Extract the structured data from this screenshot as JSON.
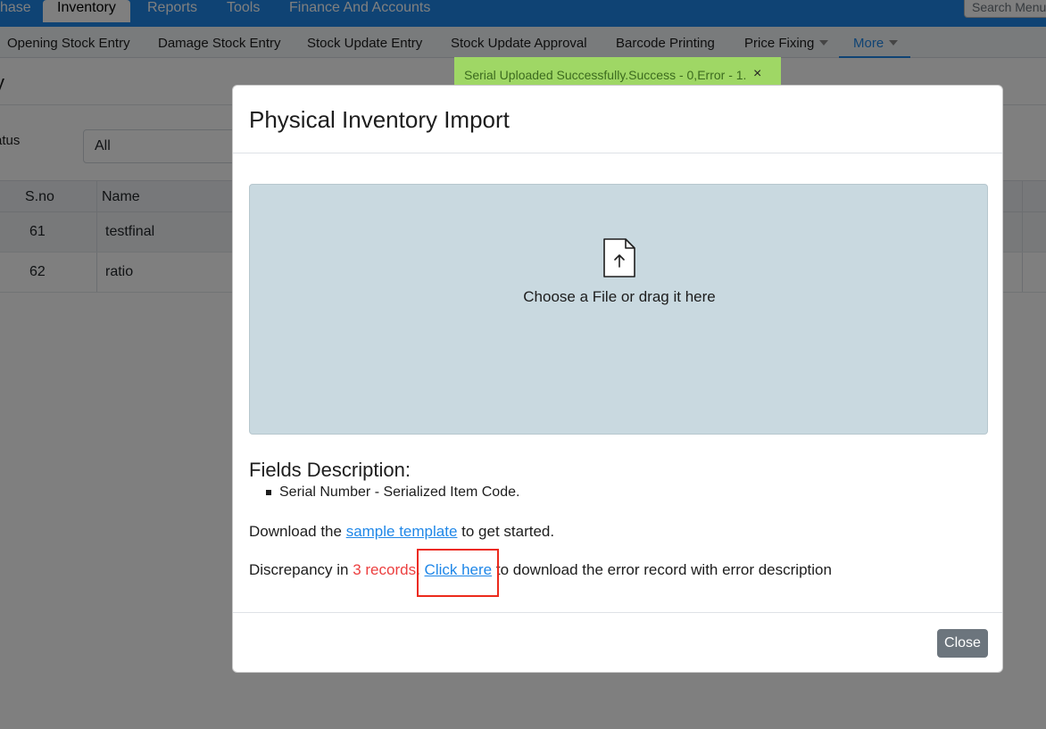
{
  "topnav": {
    "items": [
      "hase",
      "Inventory",
      "Reports",
      "Tools",
      "Finance And Accounts"
    ],
    "active": "Inventory",
    "search_placeholder": "Search Menu"
  },
  "subnav": {
    "items": [
      "Opening Stock Entry",
      "Damage Stock Entry",
      "Stock Update Entry",
      "Stock Update Approval",
      "Barcode Printing",
      "Price Fixing",
      "More"
    ]
  },
  "background": {
    "page_title": "y",
    "status_label": "atus",
    "status_value": "All",
    "columns": [
      "S.no",
      "Name"
    ],
    "rows": [
      {
        "sno": "61",
        "name": "testfinal"
      },
      {
        "sno": "62",
        "name": "ratio"
      }
    ]
  },
  "toast": {
    "message": "Serial Uploaded Successfully.Success - 0,Error - 1.",
    "close": "×",
    "color": "#9fd765"
  },
  "modal": {
    "title": "Physical Inventory Import",
    "dropzone_icon": "file-upload-icon",
    "dropzone_text": "Choose a File or drag it here",
    "fields_title": "Fields Description:",
    "fields": [
      "Serial Number - Serialized Item Code."
    ],
    "download_prefix": "Download the ",
    "download_link": "sample template",
    "download_suffix": " to get started.",
    "discrepancy_prefix": "Discrepancy in ",
    "discrepancy_count": "3 records",
    "discrepancy_sep": ". ",
    "discrepancy_link": "Click here",
    "discrepancy_suffix": " to download the error record with error description",
    "close_label": "Close"
  },
  "colors": {
    "accent": "#1f87e8",
    "error": "#ec3f3f",
    "highlight": "#ec2a1c"
  }
}
